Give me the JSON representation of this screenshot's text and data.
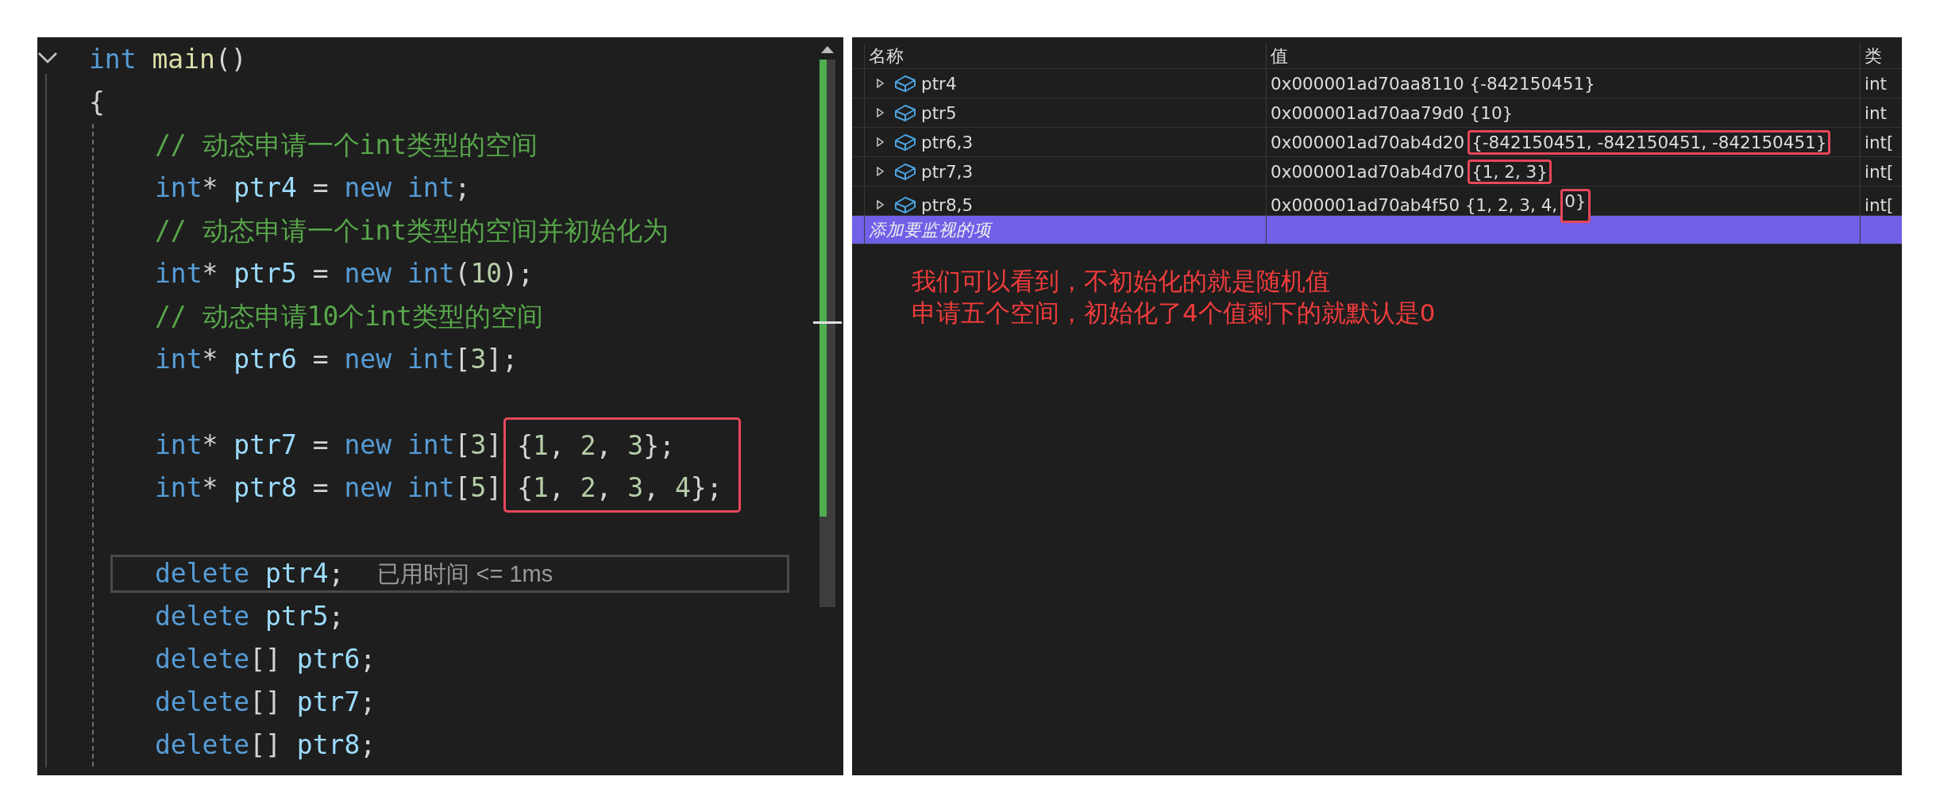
{
  "editor": {
    "fold": {
      "expanded": true
    },
    "lines": [
      {
        "kind": "code",
        "tokens": [
          {
            "t": "int",
            "kind": "keyword"
          },
          {
            "t": " main",
            "kind": "function"
          },
          {
            "t": "()",
            "kind": "plain"
          }
        ]
      },
      {
        "kind": "code",
        "tokens": [
          {
            "t": "{",
            "kind": "plain"
          }
        ]
      },
      {
        "kind": "block",
        "children": [
          {
            "kind": "code",
            "tokens": [
              {
                "t": "// 动态申请一个int类型的空间",
                "kind": "comment"
              }
            ]
          },
          {
            "kind": "code",
            "tokens": [
              {
                "t": "int",
                "kind": "keyword"
              },
              {
                "t": "* ",
                "kind": "plain"
              },
              {
                "t": "ptr4",
                "kind": "variable"
              },
              {
                "t": " = ",
                "kind": "plain"
              },
              {
                "t": "new",
                "kind": "keyword"
              },
              {
                "t": " int",
                "kind": "keyword"
              },
              {
                "t": ";",
                "kind": "plain"
              }
            ]
          },
          {
            "kind": "code",
            "tokens": [
              {
                "t": "// 动态申请一个int类型的空间并初始化为",
                "kind": "comment"
              }
            ]
          },
          {
            "kind": "code",
            "tokens": [
              {
                "t": "int",
                "kind": "keyword"
              },
              {
                "t": "* ",
                "kind": "plain"
              },
              {
                "t": "ptr5",
                "kind": "variable"
              },
              {
                "t": " = ",
                "kind": "plain"
              },
              {
                "t": "new",
                "kind": "keyword"
              },
              {
                "t": " int",
                "kind": "keyword"
              },
              {
                "t": "(",
                "kind": "plain"
              },
              {
                "t": "10",
                "kind": "number"
              },
              {
                "t": ");",
                "kind": "plain"
              }
            ]
          },
          {
            "kind": "code",
            "tokens": [
              {
                "t": "// 动态申请10个int类型的空间",
                "kind": "comment"
              }
            ]
          },
          {
            "kind": "code",
            "tokens": [
              {
                "t": "int",
                "kind": "keyword"
              },
              {
                "t": "* ",
                "kind": "plain"
              },
              {
                "t": "ptr6",
                "kind": "variable"
              },
              {
                "t": " = ",
                "kind": "plain"
              },
              {
                "t": "new",
                "kind": "keyword"
              },
              {
                "t": " int",
                "kind": "keyword"
              },
              {
                "t": "[",
                "kind": "plain"
              },
              {
                "t": "3",
                "kind": "number"
              },
              {
                "t": "];",
                "kind": "plain"
              }
            ]
          },
          {
            "kind": "blank"
          },
          {
            "kind": "boxed",
            "rows": [
              {
                "head": [
                  {
                    "t": "int",
                    "kind": "keyword"
                  },
                  {
                    "t": "* ",
                    "kind": "plain"
                  },
                  {
                    "t": "ptr7",
                    "kind": "variable"
                  },
                  {
                    "t": " = ",
                    "kind": "plain"
                  },
                  {
                    "t": "new",
                    "kind": "keyword"
                  },
                  {
                    "t": " int",
                    "kind": "keyword"
                  },
                  {
                    "t": "[",
                    "kind": "plain"
                  },
                  {
                    "t": "3",
                    "kind": "number"
                  },
                  {
                    "t": "]",
                    "kind": "plain"
                  }
                ],
                "boxed": [
                  {
                    "t": "{",
                    "kind": "plain"
                  },
                  {
                    "t": "1",
                    "kind": "number"
                  },
                  {
                    "t": ", ",
                    "kind": "plain"
                  },
                  {
                    "t": "2",
                    "kind": "number"
                  },
                  {
                    "t": ", ",
                    "kind": "plain"
                  },
                  {
                    "t": "3",
                    "kind": "number"
                  },
                  {
                    "t": "};",
                    "kind": "plain"
                  }
                ]
              },
              {
                "head": [
                  {
                    "t": "int",
                    "kind": "keyword"
                  },
                  {
                    "t": "* ",
                    "kind": "plain"
                  },
                  {
                    "t": "ptr8",
                    "kind": "variable"
                  },
                  {
                    "t": " = ",
                    "kind": "plain"
                  },
                  {
                    "t": "new",
                    "kind": "keyword"
                  },
                  {
                    "t": " int",
                    "kind": "keyword"
                  },
                  {
                    "t": "[",
                    "kind": "plain"
                  },
                  {
                    "t": "5",
                    "kind": "number"
                  },
                  {
                    "t": "]",
                    "kind": "plain"
                  }
                ],
                "boxed": [
                  {
                    "t": "{",
                    "kind": "plain"
                  },
                  {
                    "t": "1",
                    "kind": "number"
                  },
                  {
                    "t": ", ",
                    "kind": "plain"
                  },
                  {
                    "t": "2",
                    "kind": "number"
                  },
                  {
                    "t": ", ",
                    "kind": "plain"
                  },
                  {
                    "t": "3",
                    "kind": "number"
                  },
                  {
                    "t": ", ",
                    "kind": "plain"
                  },
                  {
                    "t": "4",
                    "kind": "number"
                  },
                  {
                    "t": "};",
                    "kind": "plain"
                  }
                ]
              }
            ]
          },
          {
            "kind": "blank"
          },
          {
            "kind": "code",
            "current": true,
            "hint": "已用时间 <= 1ms",
            "tokens": [
              {
                "t": "delete",
                "kind": "keyword"
              },
              {
                "t": " ptr4",
                "kind": "variable"
              },
              {
                "t": ";",
                "kind": "plain"
              }
            ]
          },
          {
            "kind": "code",
            "tokens": [
              {
                "t": "delete",
                "kind": "keyword"
              },
              {
                "t": " ptr5",
                "kind": "variable"
              },
              {
                "t": ";",
                "kind": "plain"
              }
            ]
          },
          {
            "kind": "code",
            "tokens": [
              {
                "t": "delete",
                "kind": "keyword"
              },
              {
                "t": "[]",
                "kind": "plain"
              },
              {
                "t": " ptr6",
                "kind": "variable"
              },
              {
                "t": ";",
                "kind": "plain"
              }
            ]
          },
          {
            "kind": "code",
            "tokens": [
              {
                "t": "delete",
                "kind": "keyword"
              },
              {
                "t": "[]",
                "kind": "plain"
              },
              {
                "t": " ptr7",
                "kind": "variable"
              },
              {
                "t": ";",
                "kind": "plain"
              }
            ]
          },
          {
            "kind": "code",
            "tokens": [
              {
                "t": "delete",
                "kind": "keyword"
              },
              {
                "t": "[]",
                "kind": "plain"
              },
              {
                "t": " ptr8",
                "kind": "variable"
              },
              {
                "t": ";",
                "kind": "plain"
              }
            ]
          }
        ]
      }
    ]
  },
  "watch": {
    "columns": [
      "名称",
      "值",
      "类"
    ],
    "rows": [
      {
        "name": "ptr4",
        "expanded": false,
        "value": [
          {
            "text": "0x000001ad70aa8110 {-842150451}",
            "marked": false
          }
        ],
        "type": "int"
      },
      {
        "name": "ptr5",
        "expanded": false,
        "value": [
          {
            "text": "0x000001ad70aa79d0 {10}",
            "marked": false
          }
        ],
        "type": "int"
      },
      {
        "name": "ptr6,3",
        "expanded": false,
        "value": [
          {
            "text": "0x000001ad70ab4d20",
            "marked": false
          },
          {
            "text": "{-842150451, -842150451, -842150451}",
            "marked": true
          }
        ],
        "type": "int["
      },
      {
        "name": "ptr7,3",
        "expanded": false,
        "value": [
          {
            "text": "0x000001ad70ab4d70",
            "marked": false
          },
          {
            "text": "{1, 2, 3}",
            "marked": true
          }
        ],
        "type": "int["
      },
      {
        "name": "ptr8,5",
        "expanded": false,
        "value": [
          {
            "text": "0x000001ad70ab4f50 {1, 2, 3, 4,",
            "marked": false
          },
          {
            "text": "0}",
            "marked": true
          }
        ],
        "type": "int["
      }
    ],
    "add_row": {
      "label": "添加要监视的项",
      "selected": true
    }
  },
  "note": {
    "lines": [
      "我们可以看到，不初始化的就是随机值",
      "申请五个空间，初始化了4个值剩下的就默认是0"
    ]
  }
}
